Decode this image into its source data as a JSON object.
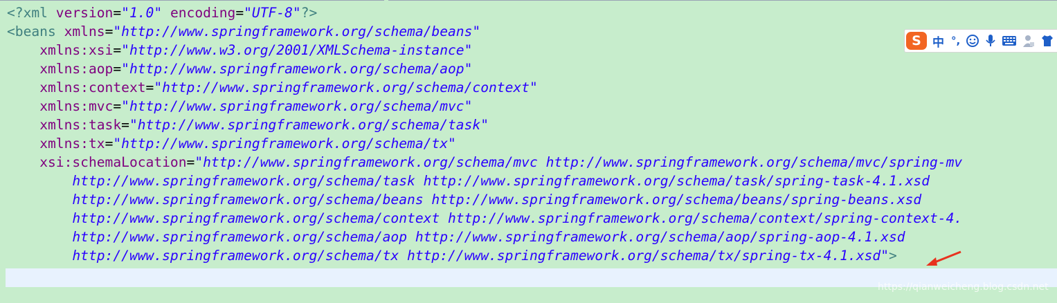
{
  "editor": {
    "lines": [
      {
        "segments": [
          {
            "cls": "pi",
            "text": "<?xml "
          },
          {
            "cls": "attr",
            "text": "version"
          },
          {
            "cls": "eq",
            "text": "="
          },
          {
            "cls": "val",
            "text": "\"1.0\""
          },
          {
            "cls": "eq",
            "text": " "
          },
          {
            "cls": "attr",
            "text": "encoding"
          },
          {
            "cls": "eq",
            "text": "="
          },
          {
            "cls": "val",
            "text": "\"UTF-8\""
          },
          {
            "cls": "pi",
            "text": "?>"
          }
        ]
      },
      {
        "segments": [
          {
            "cls": "tag",
            "text": "<beans "
          },
          {
            "cls": "attr",
            "text": "xmlns"
          },
          {
            "cls": "eq",
            "text": "="
          },
          {
            "cls": "val",
            "text": "\"http://www.springframework.org/schema/beans\""
          }
        ]
      },
      {
        "segments": [
          {
            "cls": "eq",
            "text": "    "
          },
          {
            "cls": "attr",
            "text": "xmlns:xsi"
          },
          {
            "cls": "eq",
            "text": "="
          },
          {
            "cls": "val",
            "text": "\"http://www.w3.org/2001/XMLSchema-instance\""
          }
        ]
      },
      {
        "segments": [
          {
            "cls": "eq",
            "text": "    "
          },
          {
            "cls": "attr",
            "text": "xmlns:aop"
          },
          {
            "cls": "eq",
            "text": "="
          },
          {
            "cls": "val",
            "text": "\"http://www.springframework.org/schema/aop\""
          }
        ]
      },
      {
        "segments": [
          {
            "cls": "eq",
            "text": "    "
          },
          {
            "cls": "attr",
            "text": "xmlns:context"
          },
          {
            "cls": "eq",
            "text": "="
          },
          {
            "cls": "val",
            "text": "\"http://www.springframework.org/schema/context\""
          }
        ]
      },
      {
        "segments": [
          {
            "cls": "eq",
            "text": "    "
          },
          {
            "cls": "attr",
            "text": "xmlns:mvc"
          },
          {
            "cls": "eq",
            "text": "="
          },
          {
            "cls": "val",
            "text": "\"http://www.springframework.org/schema/mvc\""
          }
        ]
      },
      {
        "segments": [
          {
            "cls": "eq",
            "text": "    "
          },
          {
            "cls": "attr",
            "text": "xmlns:task"
          },
          {
            "cls": "eq",
            "text": "="
          },
          {
            "cls": "val",
            "text": "\"http://www.springframework.org/schema/task\""
          }
        ]
      },
      {
        "segments": [
          {
            "cls": "eq",
            "text": "    "
          },
          {
            "cls": "attr",
            "text": "xmlns:tx"
          },
          {
            "cls": "eq",
            "text": "="
          },
          {
            "cls": "val",
            "text": "\"http://www.springframework.org/schema/tx\""
          }
        ]
      },
      {
        "segments": [
          {
            "cls": "eq",
            "text": "    "
          },
          {
            "cls": "attr",
            "text": "xsi:schemaLocation"
          },
          {
            "cls": "eq",
            "text": "="
          },
          {
            "cls": "val",
            "text": "\"http://www.springframework.org/schema/mvc http://www.springframework.org/schema/mvc/spring-mv"
          }
        ]
      },
      {
        "segments": [
          {
            "cls": "val",
            "text": "        http://www.springframework.org/schema/task http://www.springframework.org/schema/task/spring-task-4.1.xsd"
          }
        ]
      },
      {
        "segments": [
          {
            "cls": "val",
            "text": "        http://www.springframework.org/schema/beans http://www.springframework.org/schema/beans/spring-beans.xsd"
          }
        ]
      },
      {
        "segments": [
          {
            "cls": "val",
            "text": "        http://www.springframework.org/schema/context http://www.springframework.org/schema/context/spring-context-4."
          }
        ]
      },
      {
        "segments": [
          {
            "cls": "val",
            "text": "        http://www.springframework.org/schema/aop http://www.springframework.org/schema/aop/spring-aop-4.1.xsd"
          }
        ]
      },
      {
        "segments": [
          {
            "cls": "val",
            "text": "        http://www.springframework.org/schema/tx http://www.springframework.org/schema/tx/spring-tx-4.1.xsd\""
          },
          {
            "cls": "tag",
            "text": ">"
          }
        ]
      },
      {
        "segments": []
      }
    ]
  },
  "ime_toolbar": {
    "logo": "S",
    "items": [
      {
        "name": "chinese-mode-button",
        "label": "中"
      },
      {
        "name": "punctuation-button",
        "label": "°,"
      },
      {
        "name": "emoji-icon",
        "label": ""
      },
      {
        "name": "microphone-icon",
        "label": ""
      },
      {
        "name": "keyboard-icon",
        "label": ""
      },
      {
        "name": "user-icon",
        "label": ""
      },
      {
        "name": "shirt-icon",
        "label": ""
      }
    ]
  },
  "watermark": "https://qianweicheng.blog.csdn.net",
  "colors": {
    "background": "#c7edcc",
    "current_line": "#e8f2fe",
    "tag": "#3f7f7f",
    "attribute": "#7f007f",
    "value": "#2a00ff",
    "arrow": "#e8321e",
    "ime_brand": "#f26522",
    "ime_icons": "#1e5fc8"
  }
}
